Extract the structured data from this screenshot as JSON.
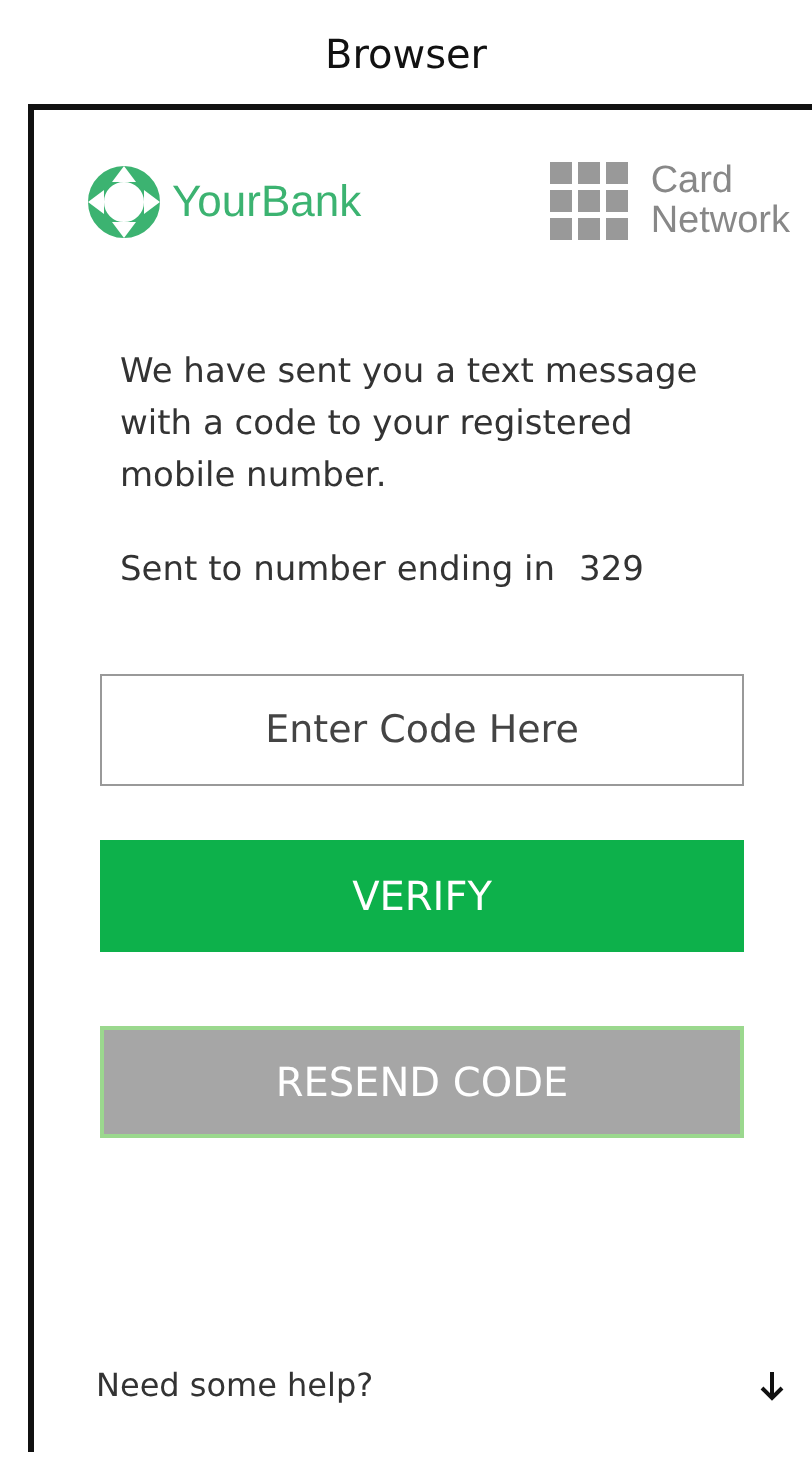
{
  "window": {
    "title": "Browser"
  },
  "header": {
    "bank_logo": "YourBank",
    "network_logo": [
      "Card",
      "Network"
    ]
  },
  "message": "We have sent you a text message with a code to your registered mobile number.",
  "sent_to": {
    "label": "Sent to number ending in",
    "digits": "329"
  },
  "code_field": {
    "placeholder": "Enter Code Here"
  },
  "buttons": [
    {
      "label": "VERIFY",
      "kind": "primary"
    },
    {
      "label": "RESEND CODE",
      "kind": "secondary"
    }
  ],
  "help": {
    "label": "Need some help?"
  }
}
